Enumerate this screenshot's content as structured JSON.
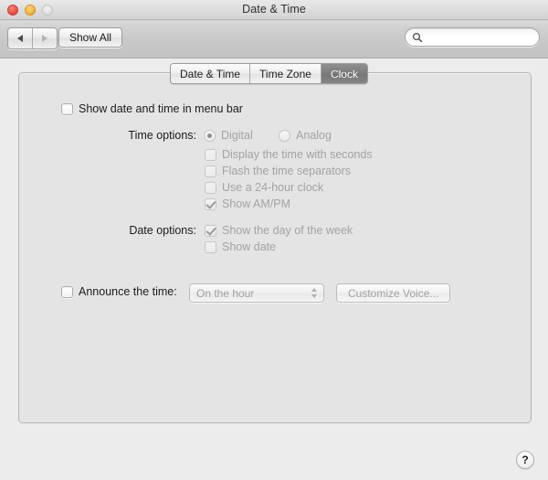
{
  "window": {
    "title": "Date & Time",
    "traffic_lights": [
      "close-button",
      "minimize-button",
      "zoom-button"
    ]
  },
  "toolbar": {
    "back_label": "back-arrow",
    "forward_label": "forward-arrow",
    "show_all_label": "Show All",
    "search": {
      "value": "",
      "placeholder": ""
    }
  },
  "tabs": [
    {
      "label": "Date & Time",
      "selected": false
    },
    {
      "label": "Time Zone",
      "selected": false
    },
    {
      "label": "Clock",
      "selected": true
    }
  ],
  "pane": {
    "menu_bar_checkbox": {
      "label": "Show date and time in menu bar",
      "checked": false,
      "enabled": true
    },
    "time_options": {
      "label": "Time options:",
      "radios": [
        {
          "label": "Digital",
          "selected": true,
          "enabled": false
        },
        {
          "label": "Analog",
          "selected": false,
          "enabled": false
        }
      ],
      "checkboxes": [
        {
          "label": "Display the time with seconds",
          "checked": false,
          "enabled": false
        },
        {
          "label": "Flash the time separators",
          "checked": false,
          "enabled": false
        },
        {
          "label": "Use a 24-hour clock",
          "checked": false,
          "enabled": false
        },
        {
          "label": "Show AM/PM",
          "checked": true,
          "enabled": false
        }
      ]
    },
    "date_options": {
      "label": "Date options:",
      "checkboxes": [
        {
          "label": "Show the day of the week",
          "checked": true,
          "enabled": false
        },
        {
          "label": "Show date",
          "checked": false,
          "enabled": false
        }
      ]
    },
    "announce": {
      "checkbox_label": "Announce the time:",
      "checked": false,
      "enabled": true,
      "interval_value": "On the hour",
      "customize_button": "Customize Voice..."
    }
  },
  "help": {
    "label": "?"
  },
  "colors": {
    "window_background": "#ececec",
    "content_background": "#e4e4e4",
    "selected_tab": "#7d7d7d",
    "enabled_text": "#1c1c1c",
    "disabled_text": "#a3a3a3"
  }
}
